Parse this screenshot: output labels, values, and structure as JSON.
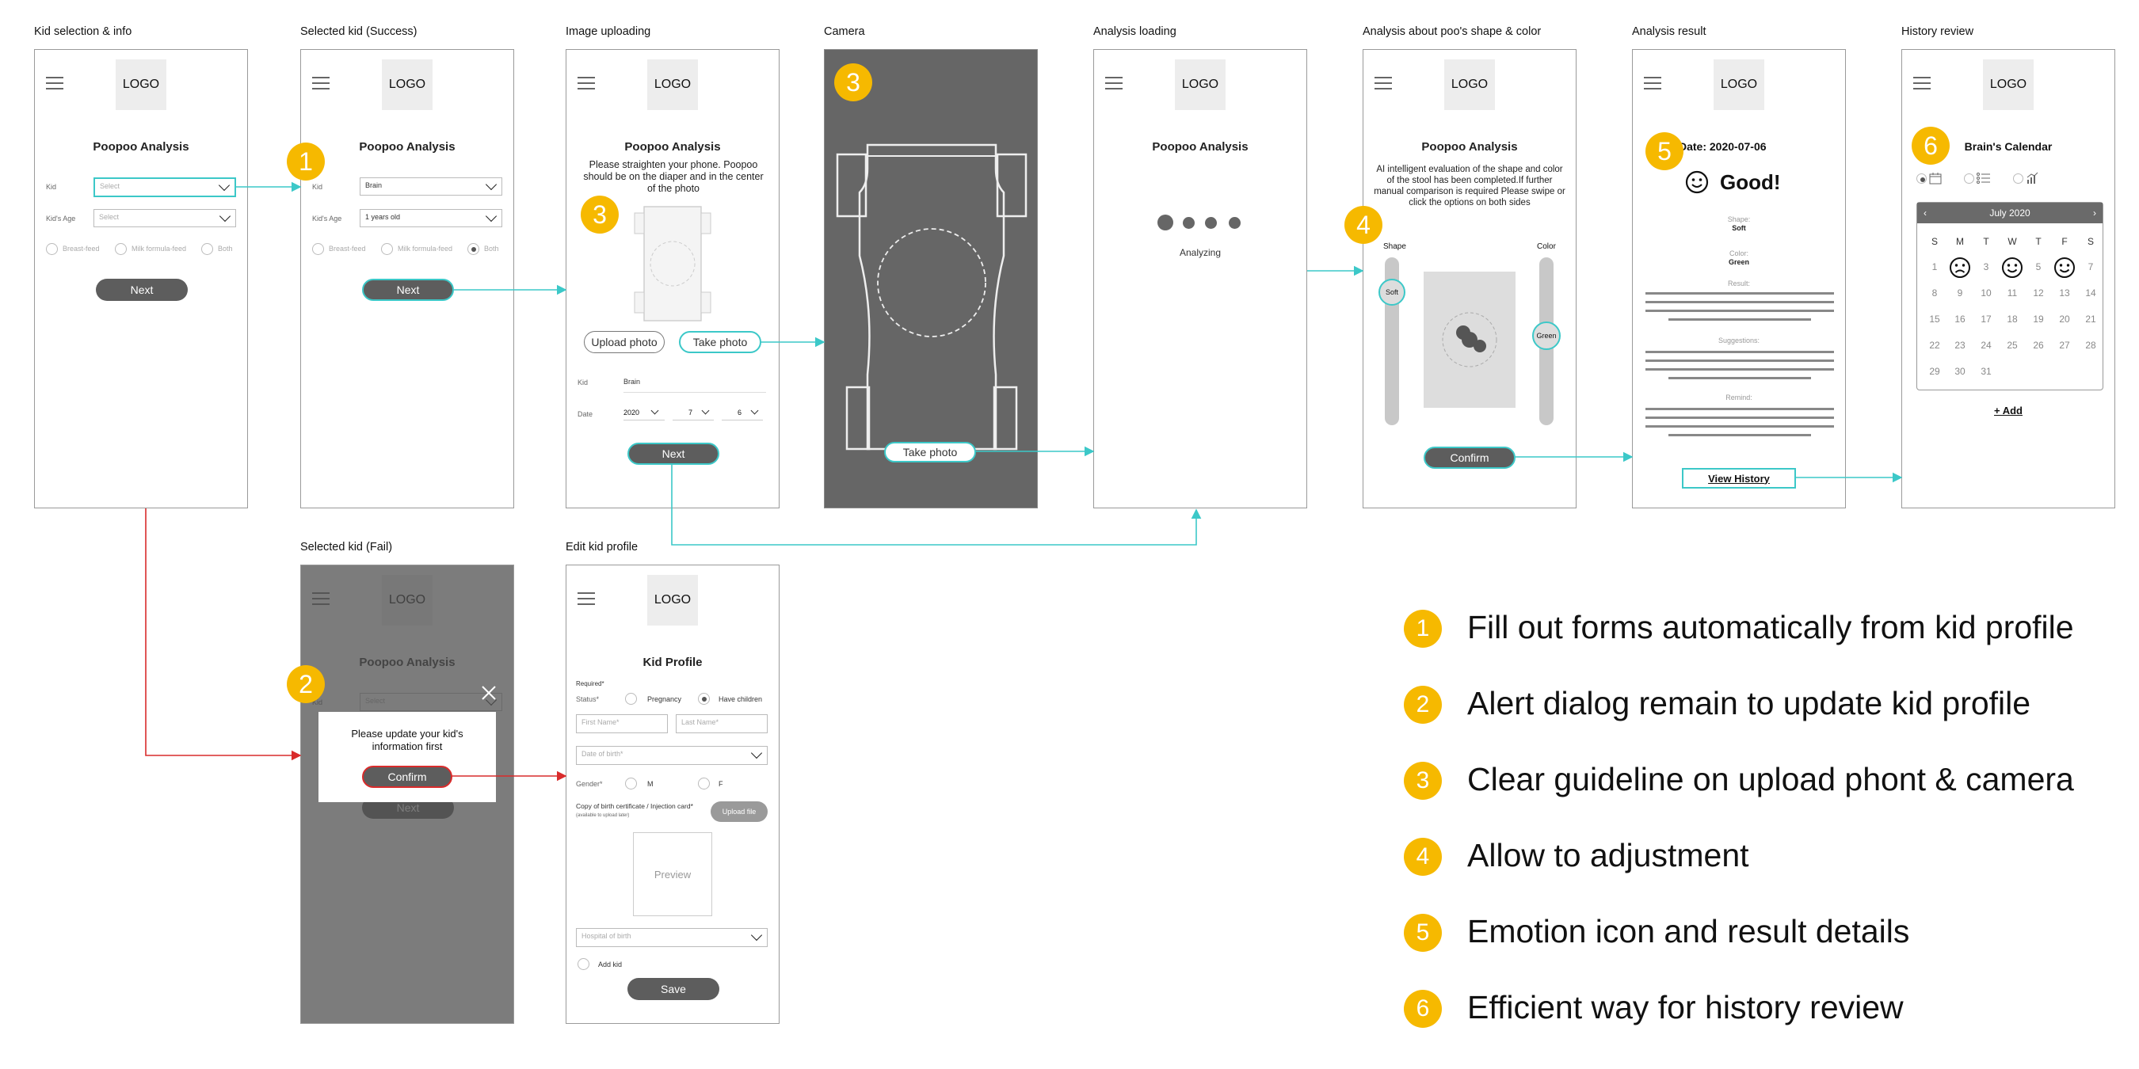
{
  "sections": {
    "s1": "Kid selection & info",
    "s2": "Selected kid (Success)",
    "s3": "Image uploading",
    "s4": "Camera",
    "s5": "Analysis loading",
    "s6": "Analysis about poo's shape & color",
    "s7": "Analysis result",
    "s8": "History review",
    "s9": "Selected kid (Fail)",
    "s10": "Edit kid profile"
  },
  "common": {
    "logo": "LOGO",
    "app_title": "Poopoo Analysis",
    "kid_label": "Kid",
    "kids_age_label": "Kid's Age",
    "select_placeholder": "Select",
    "breast_feed": "Breast-feed",
    "milk_formula": "Milk formula-feed",
    "both": "Both",
    "next": "Next"
  },
  "s2": {
    "kid_value": "Brain",
    "age_value": "1 years old"
  },
  "s3": {
    "instructions": "Please straighten your phone. Poopoo should be on the diaper and in the center of the photo",
    "upload_photo": "Upload photo",
    "take_photo": "Take photo",
    "kid_label": "Kid",
    "kid_value": "Brain",
    "date_label": "Date",
    "year": "2020",
    "month": "7",
    "day": "6"
  },
  "s4": {
    "take_photo": "Take photo"
  },
  "s5": {
    "analyzing": "Analyzing"
  },
  "s6": {
    "description": "AI intelligent evaluation of the shape and color of the stool has been completed.If further manual comparison is required Please swipe or click the options on both sides",
    "shape_label": "Shape",
    "color_label": "Color",
    "shape_value": "Soft",
    "color_value": "Green",
    "confirm": "Confirm"
  },
  "s7": {
    "date": "Date: 2020-07-06",
    "good": "Good!",
    "shape_label": "Shape:",
    "shape_value": "Soft",
    "color_label": "Color:",
    "color_value": "Green",
    "result_label": "Result:",
    "suggestions_label": "Suggestions:",
    "remind_label": "Remind:",
    "view_history": "View History"
  },
  "s8": {
    "title": "Brain's Calendar",
    "month": "July 2020",
    "weekdays": [
      "S",
      "M",
      "T",
      "W",
      "T",
      "F",
      "S"
    ],
    "days": [
      "1",
      "",
      "3",
      "",
      "5",
      "",
      "7",
      "8",
      "9",
      "10",
      "11",
      "12",
      "13",
      "14",
      "15",
      "16",
      "17",
      "18",
      "19",
      "20",
      "21",
      "22",
      "23",
      "24",
      "25",
      "26",
      "27",
      "28",
      "29",
      "30",
      "31"
    ],
    "add": "+ Add"
  },
  "s9": {
    "alert_text": "Please update your kid's information first",
    "confirm": "Confirm"
  },
  "s10": {
    "title": "Kid Profile",
    "required": "Required*",
    "status_label": "Status*",
    "pregnancy": "Pregnancy",
    "have_children": "Have children",
    "first_name": "First Name*",
    "last_name": "Last Name*",
    "dob": "Date of birth*",
    "gender_label": "Gender*",
    "male": "M",
    "female": "F",
    "copy_cert": "Copy of birth certificate / Injection card*",
    "copy_cert_note": "(available to upload later)",
    "upload_file": "Upload file",
    "preview": "Preview",
    "hospital": "Hospital of birth",
    "add_kid": "Add kid",
    "save": "Save"
  },
  "badges": [
    "1",
    "2",
    "3",
    "3",
    "4",
    "5",
    "6"
  ],
  "legend": [
    {
      "num": "1",
      "text": "Fill out forms automatically from kid profile"
    },
    {
      "num": "2",
      "text": "Alert dialog remain to update kid profile"
    },
    {
      "num": "3",
      "text": "Clear guideline on upload phont & camera"
    },
    {
      "num": "4",
      "text": "Allow to adjustment"
    },
    {
      "num": "5",
      "text": "Emotion icon and result details"
    },
    {
      "num": "6",
      "text": "Efficient way for history review"
    }
  ],
  "colors": {
    "teal": "#3cc8c8",
    "red": "#d92b2b",
    "badge": "#f6b900",
    "pill": "#5d5d5d"
  }
}
